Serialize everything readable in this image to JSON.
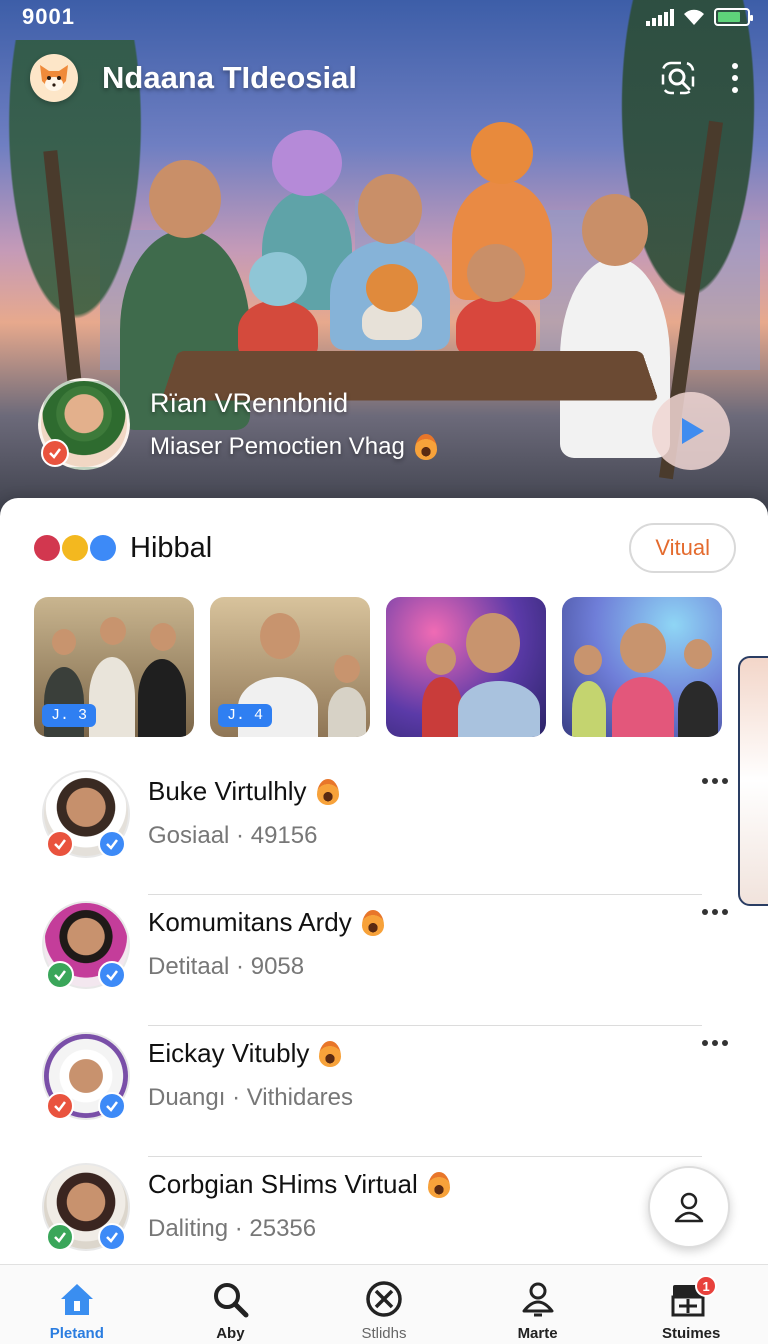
{
  "status_bar": {
    "time": "9001"
  },
  "header": {
    "title": "Ndaana TIdeosial"
  },
  "featured": {
    "name": "Rïan VRennbnid",
    "subtitle": "Miaser Pemoctien Vhag"
  },
  "section": {
    "title": "Hibbal",
    "chip_label": "Vitual"
  },
  "thumbnails": [
    {
      "badge": "J. 3"
    },
    {
      "badge": "J. 4"
    },
    {
      "badge": ""
    },
    {
      "badge": ""
    }
  ],
  "list": [
    {
      "name": "Buke Virtulhly",
      "category": "Gosiaal",
      "count": "49156",
      "status": "red"
    },
    {
      "name": "Komumitans Ardy",
      "category": "Detitaal",
      "count": "9058",
      "status": "green"
    },
    {
      "name": "Eickay Vitubly",
      "category": "Duangı",
      "count": "Vithidares",
      "status": "red"
    },
    {
      "name": "Corbgian SHims Virtual",
      "category": "Daliting",
      "count": "25356",
      "status": "green"
    }
  ],
  "meta_separator": "·",
  "tabs": [
    {
      "label": "Pletand",
      "icon": "home-icon",
      "active": true
    },
    {
      "label": "Aby",
      "icon": "search-icon",
      "active": false
    },
    {
      "label": "Stlidhs",
      "icon": "close-circle-icon",
      "active": false
    },
    {
      "label": "Marte",
      "icon": "bell-icon",
      "active": false
    },
    {
      "label": "Stuimes",
      "icon": "inbox-icon",
      "active": false,
      "badge": "1"
    }
  ],
  "colors": {
    "accent": "#2b7de0",
    "chip_text": "#e46b2e",
    "check_red": "#e9533e",
    "check_green": "#3aa65a",
    "verify_blue": "#3d8af7"
  }
}
